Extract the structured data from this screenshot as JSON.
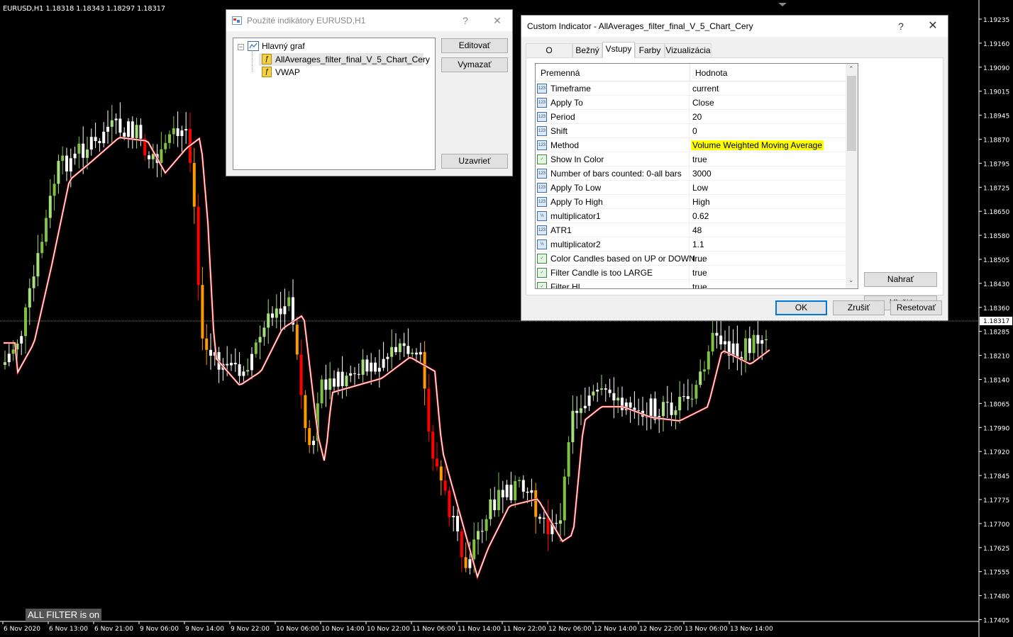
{
  "chart": {
    "symbol_header": "EURUSD,H1  1.18318 1.18343 1.18297 1.18317",
    "filter_label": "ALL FILTER is on",
    "price_labels": [
      "1.19235",
      "1.19160",
      "1.19090",
      "1.19015",
      "1.18945",
      "1.18870",
      "1.18795",
      "1.18725",
      "1.18650",
      "1.18580",
      "1.18505",
      "1.18430",
      "1.18360",
      "1.18285",
      "1.18210",
      "1.18140",
      "1.18065",
      "1.17990",
      "1.17920",
      "1.17845",
      "1.17775",
      "1.17700",
      "1.17625",
      "1.17555",
      "1.17480",
      "1.17405"
    ],
    "current_price": "1.18317",
    "time_labels": [
      "6 Nov 2020",
      "6 Nov 13:00",
      "6 Nov 21:00",
      "9 Nov 06:00",
      "9 Nov 14:00",
      "9 Nov 22:00",
      "10 Nov 06:00",
      "10 Nov 14:00",
      "10 Nov 22:00",
      "11 Nov 06:00",
      "11 Nov 14:00",
      "11 Nov 22:00",
      "12 Nov 06:00",
      "12 Nov 14:00",
      "12 Nov 22:00",
      "13 Nov 06:00",
      "13 Nov 14:00"
    ],
    "colors": {
      "bull_strong": "#7dc241",
      "bull_light": "#a6e07a",
      "bear_strong": "#ff0000",
      "bear_orange": "#ff9900",
      "neutral": "#ffffff",
      "ma_up": "#2d8a2d",
      "ma_down": "#e00000"
    }
  },
  "indicators_dialog": {
    "title": "Použité indikátory EURUSD,H1",
    "help": "?",
    "close": "✕",
    "tree": {
      "root": "Hlavný graf",
      "items": [
        "AllAverages_filter_final_V_5_Chart_Cery",
        "VWAP"
      ]
    },
    "buttons": {
      "edit": "Editovať",
      "delete": "Vymazať",
      "close": "Uzavrieť"
    }
  },
  "custom_dialog": {
    "title": "Custom Indicator - AllAverages_filter_final_V_5_Chart_Cery",
    "help": "?",
    "close": "✕",
    "tabs": [
      "O programe",
      "Bežný",
      "Vstupy",
      "Farby",
      "Vizualizácia"
    ],
    "active_tab": "Vstupy",
    "columns": {
      "name": "Premenná",
      "value": "Hodnota"
    },
    "rows": [
      {
        "icon": "123",
        "name": "Timeframe",
        "value": "current"
      },
      {
        "icon": "123",
        "name": "Apply To",
        "value": "Close"
      },
      {
        "icon": "123",
        "name": "Period",
        "value": "20"
      },
      {
        "icon": "123",
        "name": "Shift",
        "value": "0"
      },
      {
        "icon": "123",
        "name": "Method",
        "value": "Volume Weighted Moving Average",
        "highlight": true
      },
      {
        "icon": "bool",
        "name": "Show In Color",
        "value": "true"
      },
      {
        "icon": "123",
        "name": "Number of bars counted: 0-all bars",
        "value": "3000"
      },
      {
        "icon": "123",
        "name": "Apply To Low",
        "value": "Low"
      },
      {
        "icon": "123",
        "name": "Apply To High",
        "value": "High"
      },
      {
        "icon": "½",
        "name": "multiplicator1",
        "value": "0.62"
      },
      {
        "icon": "123",
        "name": "ATR1",
        "value": "48"
      },
      {
        "icon": "½",
        "name": "multiplicator2",
        "value": "1.1"
      },
      {
        "icon": "bool",
        "name": "Color Candles based on UP or DOWN ...",
        "value": "true"
      },
      {
        "icon": "bool",
        "name": "Filter Candle is too LARGE",
        "value": "true"
      },
      {
        "icon": "bool",
        "name": "Filter HL",
        "value": "true"
      }
    ],
    "side_buttons": {
      "load": "Nahrať",
      "save": "Uložiť"
    },
    "footer_buttons": {
      "ok": "OK",
      "cancel": "Zrušiť",
      "reset": "Resetovať"
    }
  }
}
